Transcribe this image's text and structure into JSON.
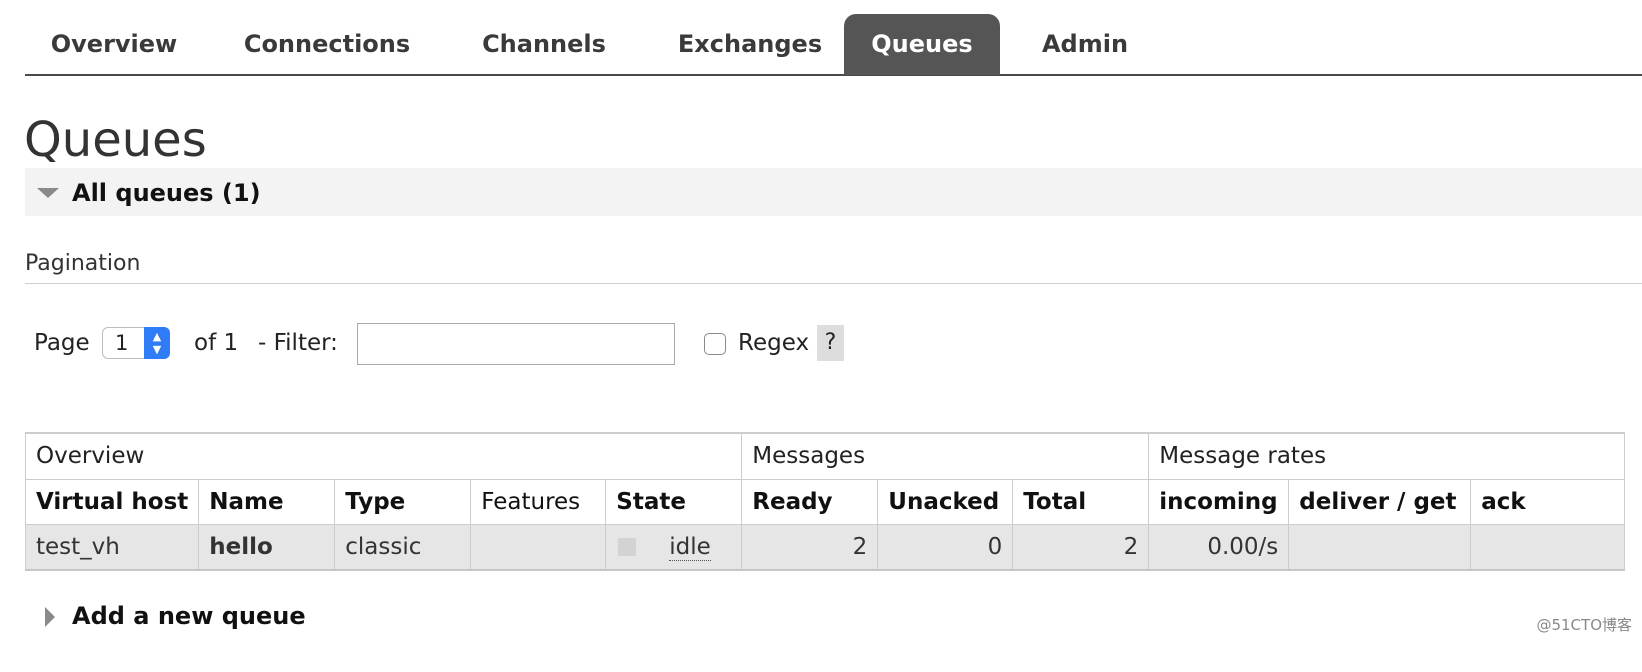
{
  "nav": {
    "tabs": [
      {
        "label": "Overview",
        "active": false
      },
      {
        "label": "Connections",
        "active": false
      },
      {
        "label": "Channels",
        "active": false
      },
      {
        "label": "Exchanges",
        "active": false
      },
      {
        "label": "Queues",
        "active": true
      },
      {
        "label": "Admin",
        "active": false
      }
    ]
  },
  "page_title": "Queues",
  "all_queues": {
    "title": "All queues (1)",
    "icon": "triangle-down-icon"
  },
  "pagination": {
    "label": "Pagination",
    "page_label": "Page",
    "page_value": "1",
    "of_label": "of 1",
    "filter_label": "- Filter:",
    "filter_value": "",
    "regex_label": "Regex",
    "regex_checked": false,
    "help_label": "?"
  },
  "table": {
    "groups": [
      "Overview",
      "Messages",
      "Message rates"
    ],
    "columns": [
      "Virtual host",
      "Name",
      "Type",
      "Features",
      "State",
      "Ready",
      "Unacked",
      "Total",
      "incoming",
      "deliver / get",
      "ack"
    ],
    "rows": [
      {
        "virtual_host": "test_vh",
        "name": "hello",
        "type": "classic",
        "features": "",
        "state": "idle",
        "ready": "2",
        "unacked": "0",
        "total": "2",
        "incoming": "0.00/s",
        "deliver_get": "",
        "ack": ""
      }
    ]
  },
  "add_queue": {
    "title": "Add a new queue",
    "icon": "triangle-right-icon"
  },
  "watermark": "@51CTO博客",
  "colors": {
    "active_tab_bg": "#555555",
    "section_bg": "#f3f3f3",
    "row_bg": "#e6e6e6",
    "stepper_blue": "#2f7cf6"
  }
}
